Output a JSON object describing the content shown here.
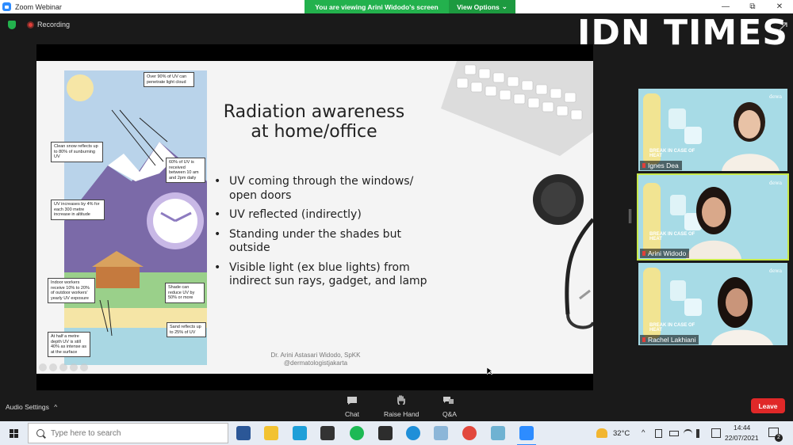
{
  "window": {
    "app_title": "Zoom Webinar",
    "share_banner": "You are viewing Arini Widodo's screen",
    "view_options": "View Options",
    "view_options_caret": "⌄",
    "minimize_icon": "—",
    "restore_icon": "⧉",
    "close_icon": "✕"
  },
  "status": {
    "recording_label": "Recording"
  },
  "overlay_logo": "IDN TIMES",
  "slide": {
    "heading_line1": "Radiation awareness",
    "heading_line2": "at home/office",
    "bullets": [
      "UV coming through the windows/ open doors",
      "UV reflected (indirectly)",
      "Standing under the shades but outside",
      "Visible light (ex blue lights) from indirect sun rays, gadget, and lamp"
    ],
    "credit_line1": "Dr. Arini Astasari Widodo, SpKK",
    "credit_line2": "@dermatologistjakarta",
    "callouts": {
      "c1": "Over 90% of UV can penetrate light cloud",
      "c2": "Clean snow reflects up to 80% of sunburning UV",
      "c3": "60% of UV is received between 10 am and 2pm daily",
      "c4": "UV increases by 4% for each 300 metre increase in altitude",
      "c5": "Indoor workers receive 10% to 20% of outdoor workers' yearly UV exposure",
      "c6": "Shade can reduce UV by 50% or more",
      "c7": "Sand reflects up to 25% of UV",
      "c8": "At half a metre depth UV is still 40% as intense as at the surface"
    }
  },
  "participants": [
    {
      "name": "Ignes Dea",
      "background_text": "BREAK IN CASE OF HEAT"
    },
    {
      "name": "Arini Widodo",
      "background_text": "BREAK IN CASE OF HEAT"
    },
    {
      "name": "Rachel Lakhiani",
      "background_text": "BREAK IN CASE OF HEAT"
    }
  ],
  "controls": {
    "audio_settings": "Audio Settings",
    "audio_caret": "^",
    "chat": "Chat",
    "raise_hand": "Raise Hand",
    "qa": "Q&A",
    "leave": "Leave"
  },
  "taskbar": {
    "search_placeholder": "Type here to search",
    "weather": "32°C",
    "time": "14:44",
    "date": "22/07/2021",
    "notification_count": "2"
  },
  "colors": {
    "zoom_blue": "#2d8cff",
    "banner_green": "#23b14d",
    "leave_red": "#e02828",
    "active_tile_border": "#c7e84a"
  }
}
